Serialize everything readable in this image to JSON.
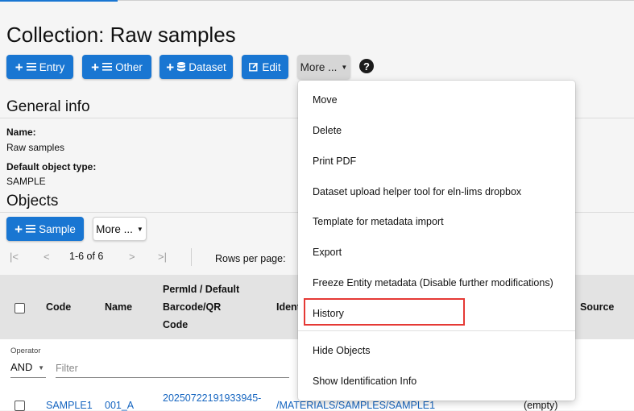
{
  "page": {
    "title": "Collection: Raw samples"
  },
  "toolbar": {
    "entry_label": "Entry",
    "other_label": "Other",
    "dataset_label": "Dataset",
    "edit_label": "Edit",
    "more_label": "More ...",
    "help_icon": "?"
  },
  "general_info": {
    "heading": "General info",
    "name_label": "Name:",
    "name_value": "Raw samples",
    "type_label": "Default object type:",
    "type_value": "SAMPLE"
  },
  "objects": {
    "heading": "Objects",
    "sample_label": "Sample",
    "more_label": "More ..."
  },
  "pagination": {
    "range": "1-6 of 6",
    "rows_per_page_label": "Rows per page:"
  },
  "table": {
    "headers": {
      "code": "Code",
      "name": "Name",
      "permid_line1": "PermId / Default",
      "permid_line2": "Barcode/QR",
      "permid_line3": "Code",
      "identifier": "Ident",
      "source": "Source"
    },
    "filter": {
      "operator_label": "Operator",
      "operator_value": "AND",
      "filter_placeholder": "Filter"
    },
    "rows": [
      {
        "code": "SAMPLE1",
        "name": "001_A",
        "permid": "20250722191933945-",
        "identifier": "/MATERIALS/SAMPLES/SAMPLE1",
        "source": "(empty)"
      }
    ]
  },
  "more_menu": {
    "items": [
      "Move",
      "Delete",
      "Print PDF",
      "Dataset upload helper tool for eln-lims dropbox",
      "Template for metadata import",
      "Export",
      "Freeze Entity metadata (Disable further modifications)",
      "History",
      "Hide Objects",
      "Show Identification Info"
    ],
    "highlighted_item": "History"
  },
  "colors": {
    "primary": "#1976d2",
    "link": "#1565c0",
    "highlight": "#e53935"
  }
}
